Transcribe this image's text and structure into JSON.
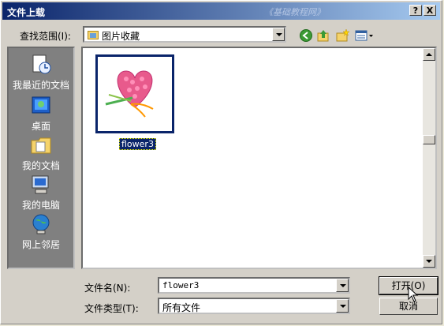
{
  "window": {
    "title": "文件上载",
    "watermark": "《基础教程网》",
    "help_label": "?",
    "close_label": "X"
  },
  "lookin": {
    "label": "查找范围(I):",
    "value": "图片收藏"
  },
  "toolbar": {
    "icons": [
      "back-icon",
      "up-folder-icon",
      "new-folder-icon",
      "view-menu-icon"
    ]
  },
  "places": [
    {
      "label": "我最近的文档",
      "icon": "recent-documents-icon"
    },
    {
      "label": "桌面",
      "icon": "desktop-icon"
    },
    {
      "label": "我的文档",
      "icon": "my-documents-icon"
    },
    {
      "label": "我的电脑",
      "icon": "my-computer-icon"
    },
    {
      "label": "网上邻居",
      "icon": "network-places-icon"
    }
  ],
  "files": [
    {
      "name": "flower3"
    }
  ],
  "filename": {
    "label": "文件名(N):",
    "value": "flower3"
  },
  "filetype": {
    "label": "文件类型(T):",
    "value": "所有文件"
  },
  "buttons": {
    "open_label": "打开(O)",
    "cancel_label": "取消"
  },
  "colors": {
    "titlebar_start": "#0a246a",
    "titlebar_end": "#a6caf0",
    "dialog_bg": "#d4d0c8",
    "sidebar_bg": "#808080",
    "selection": "#0a246a"
  }
}
